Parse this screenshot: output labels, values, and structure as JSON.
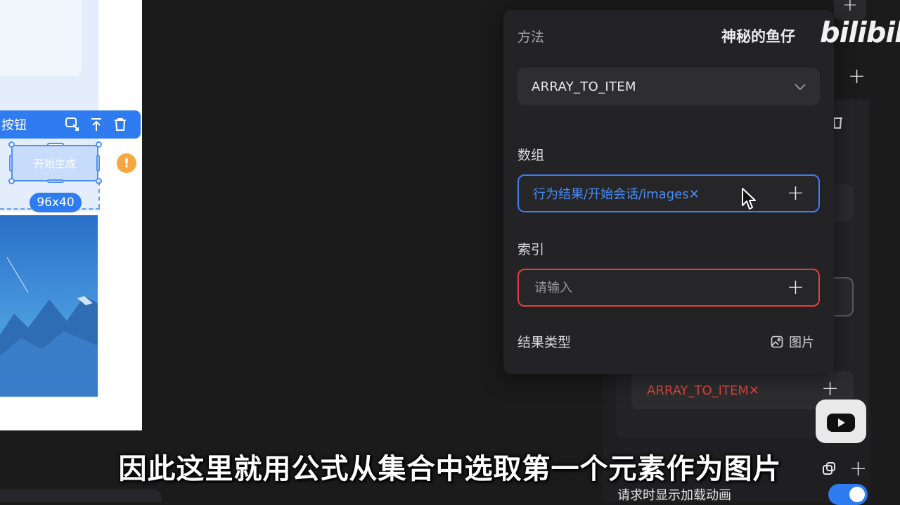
{
  "canvas": {
    "toolbar_label": "按钮",
    "selected_button_label": "开始生成",
    "size_badge": "96x40"
  },
  "popover": {
    "method_label": "方法",
    "method_value": "ARRAY_TO_ITEM",
    "array_label": "数组",
    "array_value": "行为结果/开始会话/images",
    "array_remove": "✕",
    "index_label": "索引",
    "index_placeholder": "请输入",
    "result_type_label": "结果类型",
    "result_type_value": "图片",
    "plus_symbol": "+"
  },
  "panel": {
    "formula_chip": "ARRAY_TO_ITEM",
    "formula_remove": "✕",
    "loading_animation_label": "请求时显示加载动画",
    "loading_animation_on": true,
    "plus_symbol": "+"
  },
  "overlay": {
    "author": "神秘的鱼仔",
    "logo_text": "bilibili",
    "subtitle": "因此这里就用公式从集合中选取第一个元素作为图片"
  },
  "colors": {
    "accent_blue": "#2f7cf0",
    "error_red": "#e0423b",
    "warning_orange": "#f5a742",
    "background": "#1b1b1c"
  }
}
